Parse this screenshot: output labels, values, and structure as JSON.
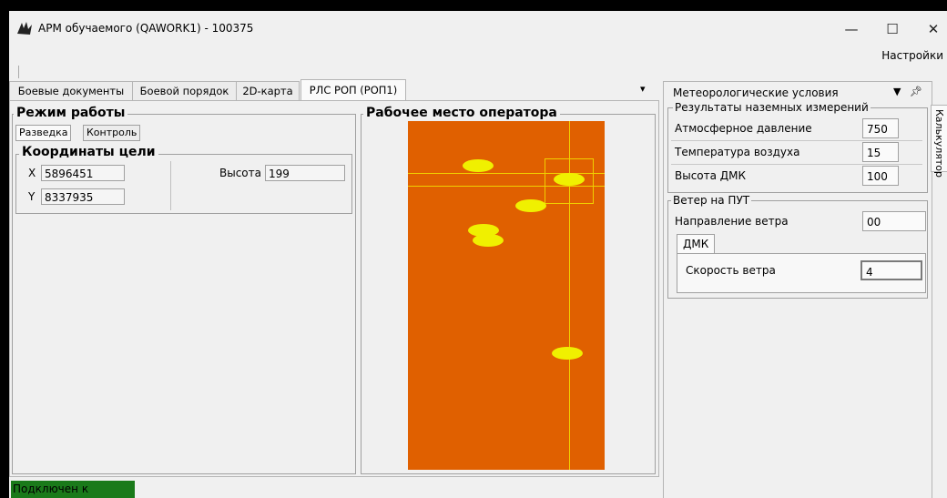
{
  "window": {
    "title": "АРМ обучаемого (QAWORK1) - 100375",
    "minimize": "—",
    "maximize": "☐",
    "close": "✕",
    "icon": "app-logo-icon"
  },
  "menu": {
    "settings": "Настройки"
  },
  "tabs": [
    {
      "label": "Боевые документы"
    },
    {
      "label": "Боевой порядок"
    },
    {
      "label": "2D-карта"
    },
    {
      "label": "РЛС РОП (РОП1)"
    }
  ],
  "tabs_dropdown": "▾",
  "mode_panel": {
    "title": "Режим работы",
    "subtabs": [
      "Разведка",
      "Контроль"
    ],
    "target_group": {
      "title": "Координаты цели",
      "x_label": "X",
      "x_value": "5896451",
      "y_label": "Y",
      "y_value": "8337935",
      "height_label": "Высота",
      "height_value": "199"
    }
  },
  "operator_panel": {
    "title": "Рабочее место оператора"
  },
  "status": {
    "text": "Подключен к серверу",
    "color": "#1a7a1a"
  },
  "meteo": {
    "header": "Метеорологические условия",
    "dropdown_icon": "▼",
    "pin_icon": "ф",
    "ground": {
      "title": "Результаты наземных измерений",
      "rows": [
        {
          "label": "Атмосферное давление",
          "value": "750"
        },
        {
          "label": "Температура воздуха",
          "value": "15"
        },
        {
          "label": "Высота ДМК",
          "value": "100"
        }
      ]
    },
    "wind": {
      "title": "Ветер на ПУТ",
      "direction_label": "Направление ветра",
      "direction_value": "00",
      "tab": "ДМК",
      "speed_label": "Скорость ветра",
      "speed_value": "4"
    }
  },
  "side_tab": {
    "label": "Калькулятор"
  },
  "colors": {
    "radar_bg": "#e06000",
    "blip": "#f0f000",
    "cursor": "#f0d000"
  }
}
